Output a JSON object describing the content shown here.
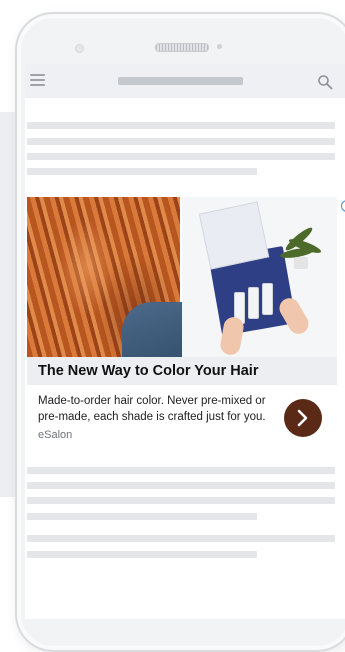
{
  "ad": {
    "headline": "The New Way to Color Your Hair",
    "description": "Made-to-order hair color. Never pre-mixed or pre-made, each shade is crafted just for you.",
    "advertiser": "eSalon",
    "info_glyph": "i",
    "cta_icon": "chevron-right-icon",
    "cta_color": "#5b2a16"
  },
  "header": {
    "menu_icon": "hamburger-menu-icon",
    "search_icon": "search-icon"
  },
  "colors": {
    "skeleton": "#e4e6ea",
    "header_bg": "#eef0f3",
    "info_icon": "#3b8fd9"
  }
}
